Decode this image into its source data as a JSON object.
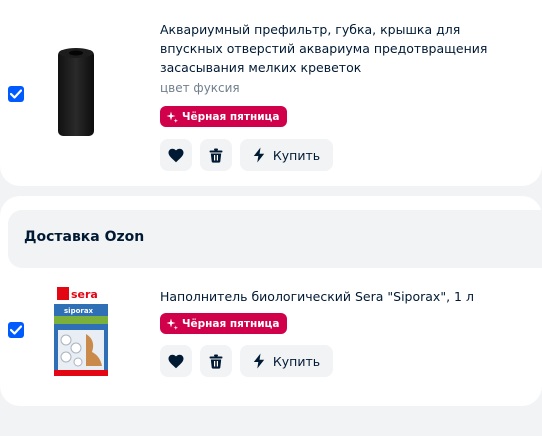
{
  "items": [
    {
      "title": "Аквариумный префильтр, губка, крышка для впускных отверстий аквариума предотвращения засасывания мелких креветок",
      "color_label": "цвет фуксия",
      "badge": "Чёрная пятница",
      "buy_label": "Купить",
      "checked": true
    },
    {
      "title": "Наполнитель биологический Sera \"Siporax\", 1 л",
      "badge": "Чёрная пятница",
      "buy_label": "Купить",
      "checked": true,
      "product_image": {
        "brand": "sera",
        "name": "siporax"
      }
    }
  ],
  "delivery_section": {
    "title": "Доставка Ozon"
  },
  "colors": {
    "accent": "#005bff",
    "badge": "#d1004a",
    "button_bg": "#f2f3f5",
    "page_bg": "#f2f3f5"
  },
  "icons": [
    "check-icon",
    "heart-icon",
    "trash-icon",
    "lightning-icon",
    "sparkle-icon"
  ]
}
